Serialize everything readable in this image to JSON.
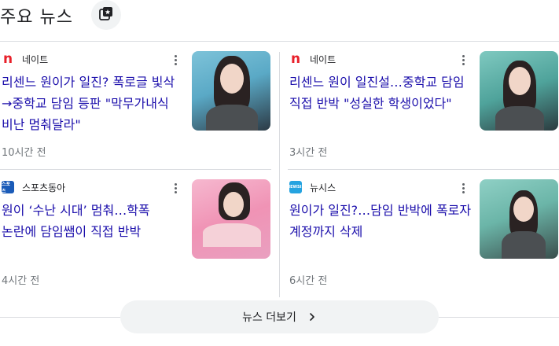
{
  "header": {
    "title": "주요 뉴스",
    "icon": "news-feed-icon"
  },
  "articles": [
    {
      "source": "네이트",
      "source_logo": "n",
      "headline": "리센느 원이가 일진? 폭로글 빛삭→중학교 담임 등판 \"막무가내식 비난 멈춰달라\"",
      "time": "10시간 전"
    },
    {
      "source": "네이트",
      "source_logo": "n",
      "headline": "리센느 원이 일진설…중학교 담임 직접 반박 \"성실한 학생이었다\"",
      "time": "3시간 전"
    },
    {
      "source": "스포츠동아",
      "source_logo": "스포츠",
      "headline": "원이 ‘수난 시대’ 멈춰…학폭 논란에 담임쌤이 직접 반박",
      "time": "4시간 전"
    },
    {
      "source": "뉴시스",
      "source_logo": "NEWSIS",
      "headline": "원이가 일진?…담임 반박에 폭로자 계정까지 삭제",
      "time": "6시간 전"
    }
  ],
  "footer": {
    "more_label": "뉴스 더보기"
  },
  "colors": {
    "headline": "#1a0dab",
    "meta": "#70757a",
    "nate": "#e8202a"
  }
}
